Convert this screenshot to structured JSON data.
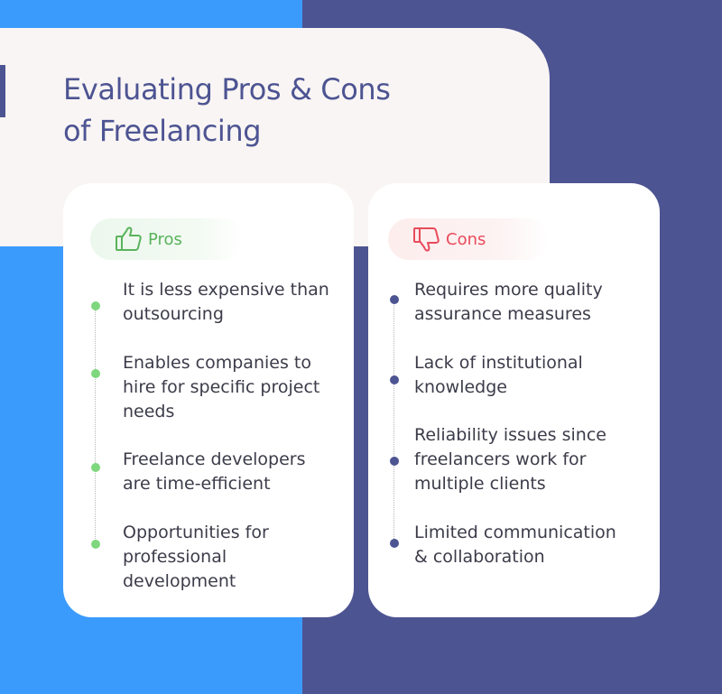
{
  "title": "Evaluating Pros  & Cons\nof Freelancing",
  "pros": {
    "label": "Pros",
    "items": [
      "It is less expensive than\noutsourcing",
      "Enables companies to\nhire for specific project\nneeds",
      "Freelance developers\nare time-efficient",
      "Opportunities for\nprofessional\ndevelopment"
    ]
  },
  "cons": {
    "label": "Cons",
    "items": [
      "Requires more quality\nassurance measures",
      "Lack of institutional\nknowledge",
      "Reliability issues since\nfreelancers work for\nmultiple clients",
      "Limited communication\n& collaboration"
    ]
  },
  "icons": {
    "pros_icon": "thumbs-up-icon",
    "cons_icon": "thumbs-down-icon"
  },
  "colors": {
    "left_background": "#3a9bfd",
    "right_background": "#4d5492",
    "header_background": "#f9f5f4",
    "title": "#4d5492",
    "pros_accent": "#5ab35c",
    "cons_accent": "#e84b5c",
    "pro_dot": "#7fd77d",
    "con_dot": "#4d5492"
  }
}
